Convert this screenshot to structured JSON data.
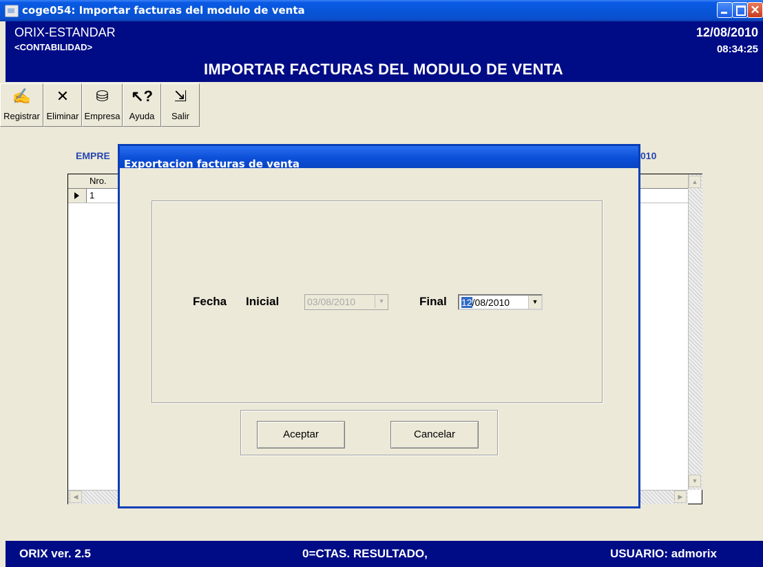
{
  "window": {
    "title": "coge054: Importar facturas del modulo de venta",
    "icons": [
      "app-icon",
      "minimize-icon",
      "maximize-icon",
      "close-icon"
    ]
  },
  "header": {
    "app_name": "ORIX-ESTANDAR",
    "module": "<CONTABILIDAD>",
    "screen_title": "IMPORTAR FACTURAS DEL MODULO DE VENTA",
    "date": "12/08/2010",
    "time": "08:34:25",
    "background_color": "#000c86"
  },
  "toolbar": {
    "items": [
      {
        "label": "Registrar",
        "icon": "register-icon"
      },
      {
        "label": "Eliminar",
        "icon": "delete-icon"
      },
      {
        "label": "Empresa",
        "icon": "company-icon"
      },
      {
        "label": "Ayuda",
        "icon": "help-icon"
      },
      {
        "label": "Salir",
        "icon": "exit-icon"
      }
    ]
  },
  "background_grid": {
    "label_left": "EMPRE",
    "label_right": "010",
    "column_header": "Nro.",
    "rows": [
      {
        "nro": "1"
      }
    ]
  },
  "dialog": {
    "title": "Exportacion facturas de venta",
    "label_fecha": "Fecha",
    "label_inicial": "Inicial",
    "date_start": "03/08/2010",
    "label_final": "Final",
    "date_end_selected": "12",
    "date_end_rest": "/08/2010",
    "accept_label": "Aceptar",
    "cancel_label": "Cancelar"
  },
  "statusbar": {
    "version": "ORIX ver. 2.5",
    "center": "0=CTAS. RESULTADO,",
    "user": "USUARIO: admorix"
  }
}
